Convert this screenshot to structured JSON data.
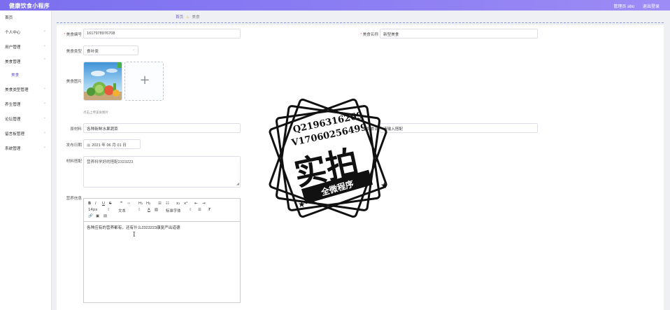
{
  "header": {
    "title": "健康饮食小程序",
    "admin_label": "管理员 abo",
    "logout_label": "退出登录"
  },
  "sidebar": {
    "items": [
      {
        "label": "首页",
        "arrow": ""
      },
      {
        "label": "个人中心",
        "arrow": "⌄"
      },
      {
        "label": "用户管理",
        "arrow": "⌄"
      },
      {
        "label": "美食管理",
        "arrow": "⌃"
      },
      {
        "label": "美食",
        "arrow": ""
      },
      {
        "label": "美食类型管理",
        "arrow": "⌄"
      },
      {
        "label": "养生管理",
        "arrow": "⌄"
      },
      {
        "label": "论坛管理",
        "arrow": "⌄"
      },
      {
        "label": "留言板管理",
        "arrow": "⌄"
      },
      {
        "label": "系统管理",
        "arrow": "⌄"
      }
    ]
  },
  "breadcrumb": {
    "home": "首页",
    "sep_icon": "flame-icon",
    "current": "美食"
  },
  "form": {
    "code": {
      "label": "美食编号",
      "value": "1617978976708"
    },
    "name": {
      "label": "美食名称",
      "value": "新型美食"
    },
    "type": {
      "label": "美食类型",
      "value": "食补类"
    },
    "image": {
      "label": "美食图片",
      "upload_icon": "+",
      "hint": "点击上传美食图片"
    },
    "ingredients": {
      "label": "原材料",
      "value": "各种新鲜水果蔬菜"
    },
    "tips": {
      "label": "搭配食谱",
      "value": "请输入搭配"
    },
    "date": {
      "label": "发布日期",
      "icon": "calendar-icon",
      "value": "2021 年 06 月 01 日"
    },
    "pairing": {
      "label": "材料搭配",
      "value": "营养科学好的搭配2323223"
    },
    "nutrition": {
      "label": "营养信息",
      "toolbar_row1": [
        "B",
        "I",
        "U",
        "S",
        "❞",
        "‹›",
        "H₁",
        "H₂",
        "☰",
        "☷",
        "x₂",
        "x²",
        "⇤",
        "⇥"
      ],
      "font_size": "14px",
      "font_kind": "文本",
      "font_color": "A",
      "font_family": "标准字体",
      "toolbar_row2": [
        "🔗",
        "▣",
        "▤"
      ],
      "content": "各种应有的营养都有，还有什么2323223康复严出道德"
    }
  },
  "watermark": {
    "qq": "Q2196316269",
    "vx": "V17060256499",
    "big": "实拍",
    "ribbon": "全微程序"
  },
  "colors": {
    "accent": "#7b6ff0",
    "required": "#f56c6c"
  }
}
